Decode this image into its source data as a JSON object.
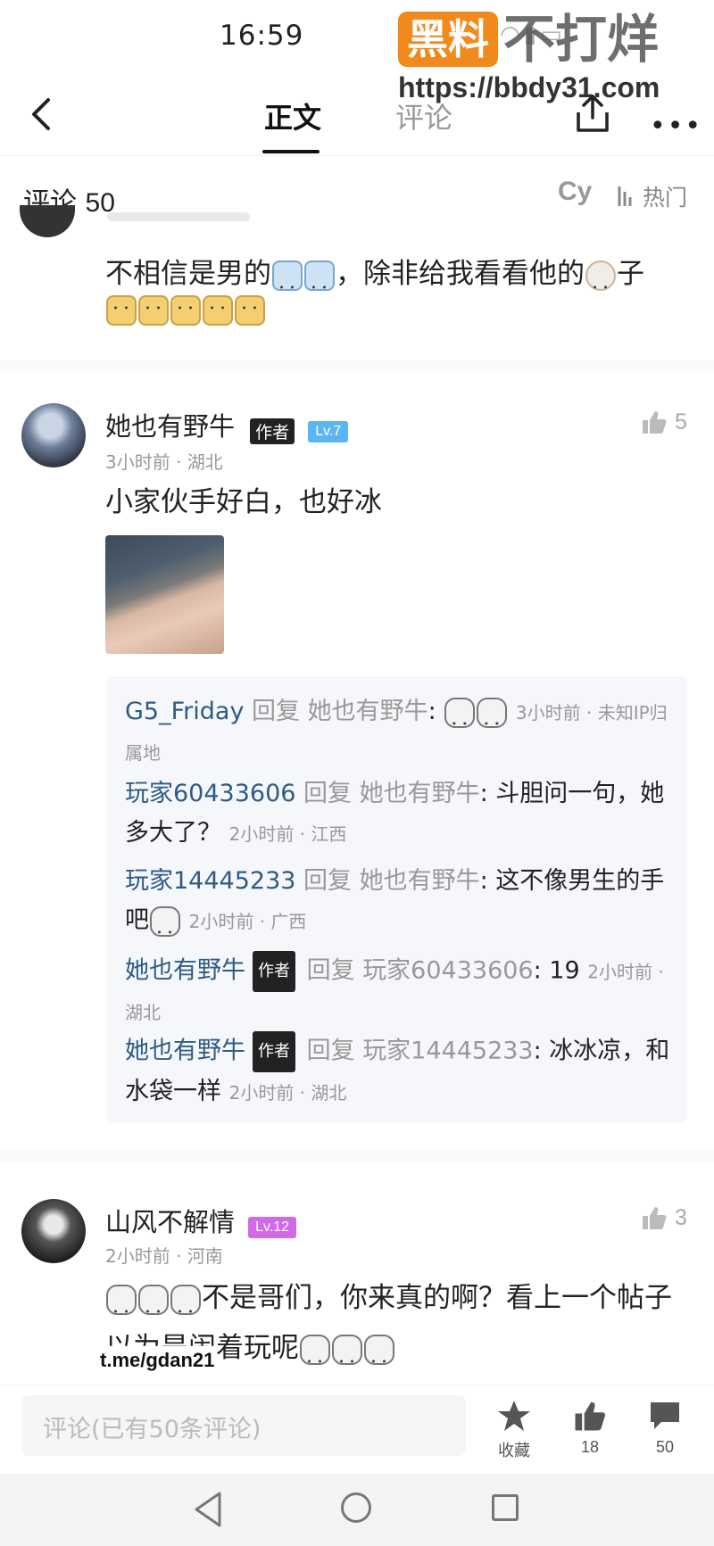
{
  "status": {
    "time": "16:59"
  },
  "watermark": {
    "brand": "黑料",
    "brand_tail": "不打烊",
    "url": "https://bbdy31.com"
  },
  "nav": {
    "tab_main": "正文",
    "tab_comments": "评论",
    "more": "•••"
  },
  "comments_header": {
    "label": "评论",
    "count": "50",
    "sort_cy": "Cy",
    "sort_hot": "热门"
  },
  "cut_comment": {
    "text_a": "不相信是男的",
    "text_b": "，除非给我看看他的",
    "text_c": "子"
  },
  "comment1": {
    "user": "她也有野牛",
    "author_badge": "作者",
    "level": "Lv.7",
    "meta": "3小时前 · 湖北",
    "likes": "5",
    "text": "小家伙手好白，也好冰",
    "replies": [
      {
        "user": "G5_Friday",
        "verb": "回复",
        "target": "她也有野牛",
        "text": ":",
        "meta": "3小时前 · 未知IP归属地"
      },
      {
        "user": "玩家60433606",
        "verb": "回复",
        "target": "她也有野牛",
        "text": ": 斗胆问一句，她多大了？",
        "meta": "2小时前 · 江西"
      },
      {
        "user": "玩家14445233",
        "verb": "回复",
        "target": "她也有野牛",
        "text": ": 这不像男生的手吧",
        "meta": "2小时前 · 广西"
      },
      {
        "user": "她也有野牛",
        "badge": "作者",
        "verb": "回复",
        "target": "玩家60433606",
        "text": ": 19",
        "meta": "2小时前 · 湖北"
      },
      {
        "user": "她也有野牛",
        "badge": "作者",
        "verb": "回复",
        "target": "玩家14445233",
        "text": ": 冰冰凉，和水袋一样",
        "meta": "2小时前 · 湖北"
      }
    ]
  },
  "comment2": {
    "user": "山风不解情",
    "level": "Lv.12",
    "meta": "2小时前 · 河南",
    "likes": "3",
    "line1": "不是哥们，你来真的啊？看上一个帖子",
    "line2_prefix": "以为是闹",
    "line2": "着玩呢"
  },
  "overlay": {
    "telegram": "t.me/gdan21"
  },
  "bottom": {
    "input_placeholder": "评论(已有50条评论)",
    "fav_label": "收藏",
    "like_count": "18",
    "comment_count": "50"
  },
  "colors": {
    "reply_name": "#2e5b86",
    "level7": "#5ab6f0",
    "level12": "#d06be8",
    "watermark": "#f08a1c"
  }
}
